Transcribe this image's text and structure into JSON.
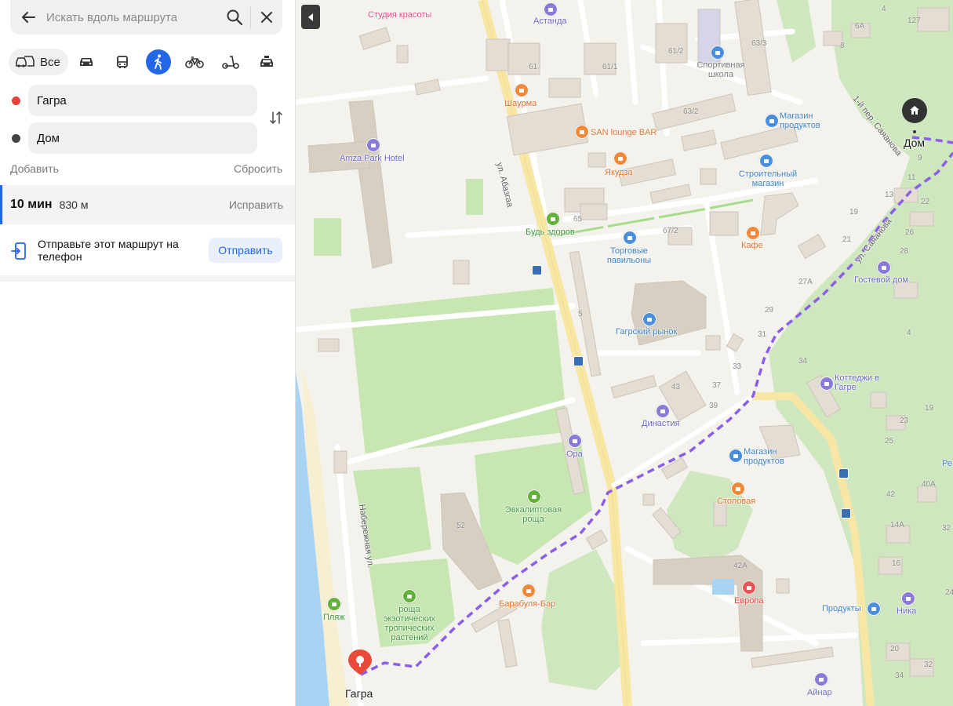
{
  "search": {
    "placeholder": "Искать вдоль маршрута"
  },
  "modes": {
    "all_label": "Все",
    "active": "pedestrian"
  },
  "waypoints": [
    {
      "value": "Гагра",
      "dot_color": "#e8403a"
    },
    {
      "value": "Дом",
      "dot_color": "#444444"
    }
  ],
  "actions": {
    "add": "Добавить",
    "reset": "Сбросить"
  },
  "route": {
    "time": "10 мин",
    "distance": "830 м",
    "fix": "Исправить"
  },
  "send": {
    "text": "Отправьте этот маршрут на телефон",
    "button": "Отправить"
  },
  "colors": {
    "accent": "#2466e8",
    "route": "#8a5ee8",
    "park": "#c7e6b2",
    "water": "#a9d3f2"
  },
  "map": {
    "origin_label": "Гагра",
    "destination_label": "Дом",
    "streets": {
      "abazgaa": "ул. Абазгаа",
      "naberezhnaya": "Набережная ул.",
      "saayanova": "ул. Саяанова",
      "lane": "1-й пер. Саяанова"
    },
    "pois": {
      "studiya": "Студия красоты",
      "astanda": "Астанда",
      "sport": "Спортивная школа",
      "shaurma": "Шаурма",
      "san": "SAN lounge BAR",
      "magazin1": "Магазин продуктов",
      "amza": "Amza Park Hotel",
      "yakudza": "Якудза",
      "stroit": "Строительный магазин",
      "budz": "Будь здоров",
      "torg": "Торговые павильоны",
      "kafe": "Кафе",
      "gostevoy": "Гостевой дом",
      "rynok": "Гагрский рынок",
      "kottedzhi": "Коттеджи в Гагре",
      "dinastiya": "Династия",
      "ora": "Ора",
      "magazin2": "Магазин продуктов",
      "stolovaya": "Столовая",
      "evkalipt": "Эвкалиптовая роща",
      "bar": "Барабуля-Бар",
      "evropa": "Европа",
      "produkty": "Продукты",
      "nika": "Ника",
      "plyazh": "Пляж",
      "roshcha": "роща экзотических тропических растений",
      "aynar": "Айнар",
      "re": "Ре"
    },
    "house_numbers": [
      "61",
      "61/1",
      "61/2",
      "63/3",
      "63/2",
      "65",
      "67/2",
      "5",
      "43",
      "37",
      "39",
      "33",
      "31",
      "29",
      "27А",
      "21",
      "19",
      "13",
      "11",
      "9",
      "6А",
      "4",
      "127",
      "8",
      "22",
      "26",
      "28",
      "34",
      "25",
      "23",
      "19",
      "42",
      "40А",
      "14А",
      "16",
      "20",
      "32",
      "34",
      "24",
      "32",
      "42А",
      "52",
      "4"
    ]
  }
}
